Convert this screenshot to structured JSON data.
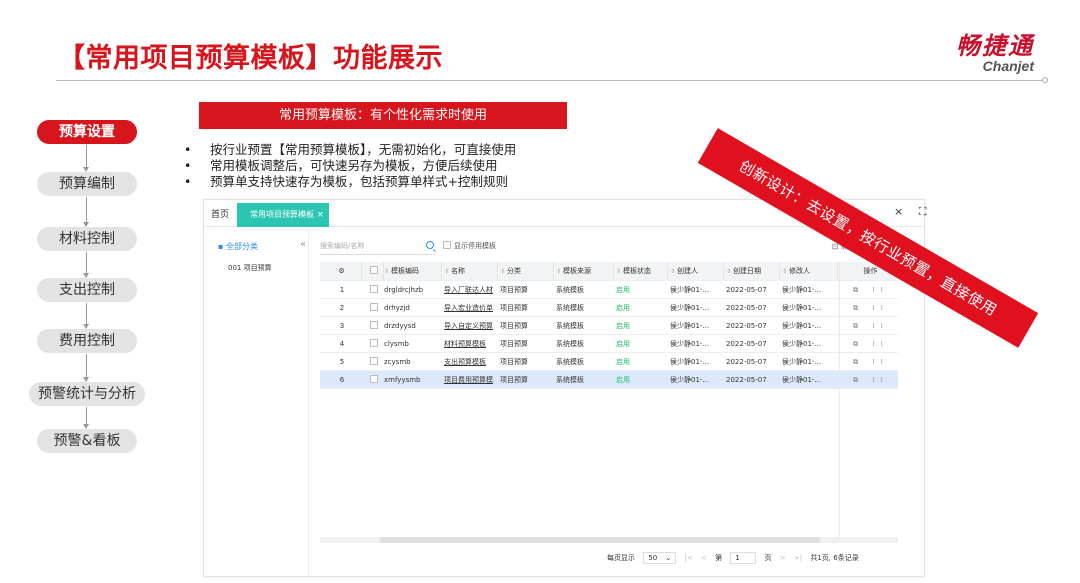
{
  "slide": {
    "title": "【常用项目预算模板】功能展示",
    "brand_cn": "畅捷通",
    "brand_en": "Chanjet"
  },
  "flow": {
    "items": [
      "预算设置",
      "预算编制",
      "材料控制",
      "支出控制",
      "费用控制",
      "预警统计与分析",
      "预警&看板"
    ],
    "active_index": 0
  },
  "banner": "常用预算模板：有个性化需求时使用",
  "bullets": [
    "按行业预置【常用预算模板】，无需初始化，可直接使用",
    "常用模板调整后，可快速另存为模板，方便后续使用",
    "预算单支持快速存为模板，包括预算单样式+控制规则"
  ],
  "ribbon": "创新设计：去设置，按行业预置，直接使用",
  "app": {
    "tabs": {
      "home": "首页",
      "active": "常用项目预算模板",
      "close": "×"
    },
    "window_controls": "× ⛶",
    "sidebar": {
      "all": "全部分类",
      "collapse": "«",
      "item": "001 项目预算"
    },
    "search_placeholder": "搜索编码/名称",
    "show_disabled": "显示停用模板",
    "corner_icon": "⊡ 新",
    "columns": [
      "⚙",
      "",
      "模板编码",
      "名称",
      "分类",
      "模板来源",
      "模板状态",
      "创建人",
      "创建日期",
      "修改人",
      "操作"
    ],
    "rows": [
      {
        "no": "1",
        "code": "drgldrcjhzb",
        "name": "导入厂联达人材",
        "category": "项目预算",
        "source": "系统模板",
        "status": "启用",
        "creator": "侯少静01-...",
        "created": "2022-05-07",
        "modifier": "侯少静01-...",
        "ops": "⧉ ⁞⁞"
      },
      {
        "no": "2",
        "code": "drhyzjd",
        "name": "导入宏业造价单",
        "category": "项目预算",
        "source": "系统模板",
        "status": "启用",
        "creator": "侯少静01-...",
        "created": "2022-05-07",
        "modifier": "侯少静01-...",
        "ops": "⧉ ⁞⁞"
      },
      {
        "no": "3",
        "code": "drzdyysd",
        "name": "导入自定义预算",
        "category": "项目预算",
        "source": "系统模板",
        "status": "启用",
        "creator": "侯少静01-...",
        "created": "2022-05-07",
        "modifier": "侯少静01-...",
        "ops": "⧉ ⁞⁞"
      },
      {
        "no": "4",
        "code": "clysmb",
        "name": "材料预算模板",
        "category": "项目预算",
        "source": "系统模板",
        "status": "启用",
        "creator": "侯少静01-...",
        "created": "2022-05-07",
        "modifier": "侯少静01-...",
        "ops": "⧉ ⁞⁞"
      },
      {
        "no": "5",
        "code": "zcysmb",
        "name": "支出预算模板",
        "category": "项目预算",
        "source": "系统模板",
        "status": "启用",
        "creator": "侯少静01-...",
        "created": "2022-05-07",
        "modifier": "侯少静01-...",
        "ops": "⧉ ⁞⁞"
      },
      {
        "no": "6",
        "code": "xmfyysmb",
        "name": "项目费用预算模",
        "category": "项目预算",
        "source": "系统模板",
        "status": "启用",
        "creator": "侯少静01-...",
        "created": "2022-05-07",
        "modifier": "侯少静01-...",
        "ops": "⧉ ⁞⁞"
      }
    ],
    "selected_row": 6,
    "pager": {
      "per_page_label": "每页显示",
      "per_page": "50",
      "first": "|<",
      "prev": "<",
      "page_prefix": "第",
      "page": "1",
      "page_suffix": "页",
      "next": ">",
      "last": ">|",
      "summary": "共1页, 6条记录"
    }
  }
}
